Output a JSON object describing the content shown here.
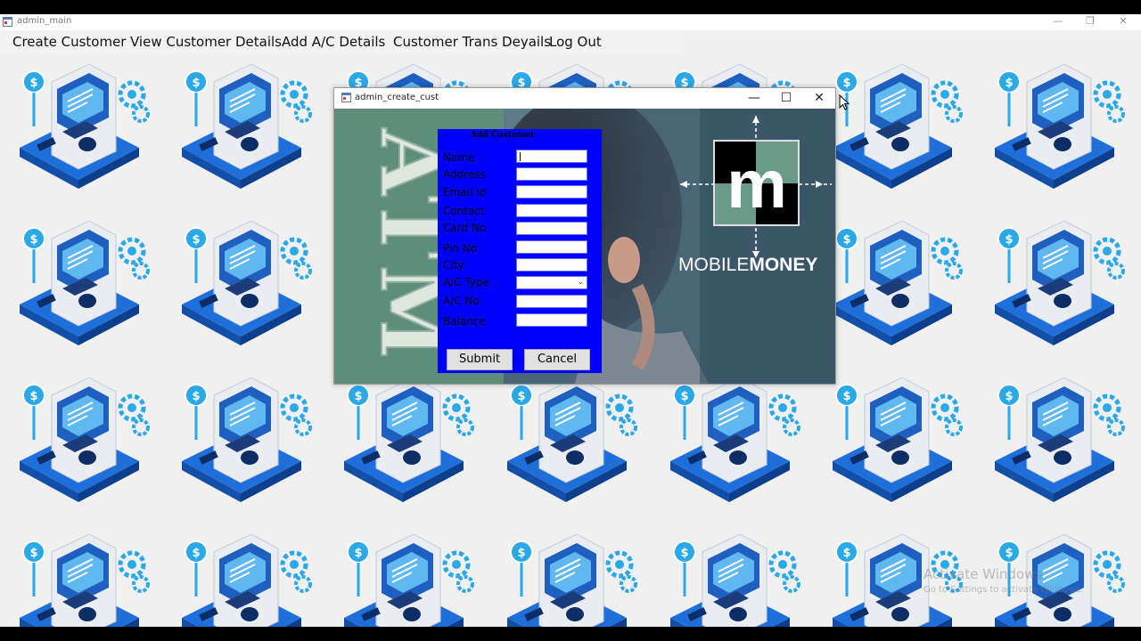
{
  "main_window": {
    "title": "admin_main",
    "controls": {
      "minimize": "—",
      "restore": "❐",
      "close": "✕"
    }
  },
  "menu": {
    "items": [
      {
        "label": "Create Customer"
      },
      {
        "label": "View Customer Details"
      },
      {
        "label": "Add A/C Details"
      },
      {
        "label": "Customer Trans Deyails"
      },
      {
        "label": "Log Out"
      }
    ]
  },
  "dialog": {
    "title": "admin_create_cust",
    "controls": {
      "minimize": "—",
      "maximize": "☐",
      "close": "✕"
    },
    "banner": "ATM",
    "logo": {
      "letter": "m",
      "text_light": "MOBILE",
      "text_bold": "MONEY"
    },
    "form": {
      "heading": "Add Customer",
      "fields": [
        {
          "label": "Name",
          "value": ""
        },
        {
          "label": "Address",
          "value": ""
        },
        {
          "label": "Email Id",
          "value": ""
        },
        {
          "label": "Contact",
          "value": ""
        },
        {
          "label": "Card No",
          "value": ""
        },
        {
          "label": "Pin No",
          "value": ""
        },
        {
          "label": "City",
          "value": ""
        },
        {
          "label": "A/C Type",
          "value": ""
        },
        {
          "label": "A/C No",
          "value": ""
        },
        {
          "label": "Balance",
          "value": ""
        }
      ],
      "submit_label": "Submit",
      "cancel_label": "Cancel"
    }
  },
  "watermark": {
    "line1": "Activate Windows",
    "line2": "Go to Settings to activate Windows."
  },
  "colors": {
    "form_bg": "#0000ff",
    "tile_blue": "#1e6fd9",
    "tile_cyan": "#2aa8e8"
  }
}
